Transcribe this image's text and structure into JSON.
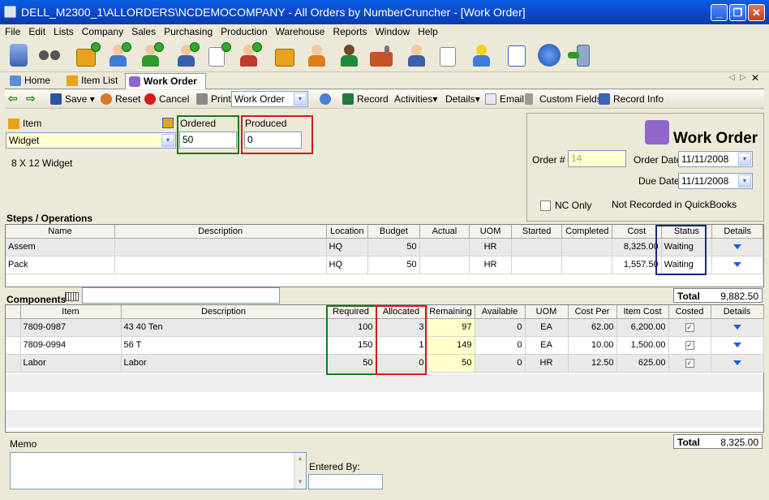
{
  "window": {
    "title": "DELL_M2300_1\\ALLORDERS\\NCDEMOCOMPANY - All Orders by NumberCruncher - [Work Order]",
    "minimize_glyph": "_",
    "restore_glyph": "❐",
    "close_glyph": "✕"
  },
  "menu": [
    "File",
    "Edit",
    "Lists",
    "Company",
    "Sales",
    "Purchasing",
    "Production",
    "Warehouse",
    "Reports",
    "Window",
    "Help"
  ],
  "tabs": {
    "home": "Home",
    "item_list": "Item List",
    "work_order": "Work Order",
    "nav_prev": "◁",
    "nav_next": "▷",
    "close": "✕"
  },
  "toolbar": {
    "save": "Save",
    "reset": "Reset",
    "cancel": "Cancel",
    "print": "Print",
    "print_target": "Work Order",
    "record": "Record",
    "activities": "Activities",
    "details": "Details",
    "email": "Email",
    "custom_fields": "Custom Fields",
    "record_info": "Record Info",
    "dropdown_glyph": "▾",
    "back_glyph": "⇦",
    "forward_glyph": "⇨"
  },
  "item": {
    "label": "Item",
    "value": "Widget",
    "description": "8 X 12 Widget"
  },
  "ordered": {
    "label": "Ordered",
    "value": "50"
  },
  "produced": {
    "label": "Produced",
    "value": "0"
  },
  "order": {
    "heading": "Work Order",
    "order_no_label": "Order #",
    "order_no": "14",
    "order_date_label": "Order Date",
    "order_date": "11/11/2008",
    "due_date_label": "Due Date",
    "due_date": "11/11/2008",
    "nc_only_label": "NC Only",
    "qb_status": "Not Recorded in QuickBooks"
  },
  "steps": {
    "section_label": "Steps / Operations",
    "columns": [
      "Name",
      "Description",
      "Location",
      "Budget",
      "Actual",
      "UOM",
      "Started",
      "Completed",
      "Cost",
      "Status",
      "Details"
    ],
    "rows": [
      {
        "name": "Assem",
        "description": "",
        "location": "HQ",
        "budget": "50",
        "actual": "",
        "uom": "HR",
        "started": "",
        "completed": "",
        "cost": "8,325.00",
        "status": "Waiting"
      },
      {
        "name": "Pack",
        "description": "",
        "location": "HQ",
        "budget": "50",
        "actual": "",
        "uom": "HR",
        "started": "",
        "completed": "",
        "cost": "1,557.50",
        "status": "Waiting"
      }
    ],
    "total_label": "Total",
    "total": "9,882.50"
  },
  "components": {
    "section_label": "Components",
    "columns": [
      "Item",
      "Description",
      "Required",
      "Allocated",
      "Remaining",
      "Available",
      "UOM",
      "Cost Per",
      "Item Cost",
      "Costed",
      "Details"
    ],
    "rows": [
      {
        "item": "7809-0987",
        "description": "43 40 Ten",
        "required": "100",
        "allocated": "3",
        "remaining": "97",
        "available": "0",
        "uom": "EA",
        "cost_per": "62.00",
        "item_cost": "6,200.00",
        "costed_glyph": "✓"
      },
      {
        "item": "7809-0994",
        "description": "56 T",
        "required": "150",
        "allocated": "1",
        "remaining": "149",
        "available": "0",
        "uom": "EA",
        "cost_per": "10.00",
        "item_cost": "1,500.00",
        "costed_glyph": "✓"
      },
      {
        "item": "Labor",
        "description": "Labor",
        "required": "50",
        "allocated": "0",
        "remaining": "50",
        "available": "0",
        "uom": "HR",
        "cost_per": "12.50",
        "item_cost": "625.00",
        "costed_glyph": "✓"
      }
    ],
    "total_label": "Total",
    "total": "8,325.00"
  },
  "memo": {
    "label": "Memo",
    "value": "",
    "scroll_up": "▲",
    "scroll_down": "▼"
  },
  "entered_by": {
    "label": "Entered By:",
    "value": ""
  },
  "colors": {
    "title_blue": "#0d47c7",
    "highlight_green": "#177a17",
    "highlight_red": "#d61b1b",
    "highlight_navy": "#1c2a7a",
    "field_yellow": "#ffffcc",
    "item_field_bg": "#ffffd0"
  }
}
